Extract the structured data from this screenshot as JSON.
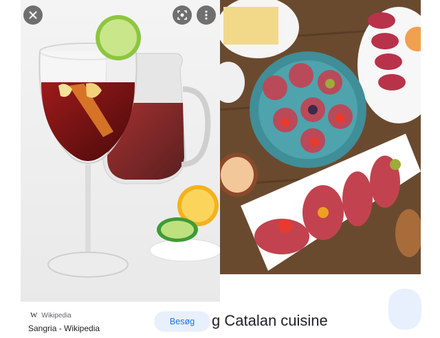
{
  "left_result": {
    "image_alt": "Sangria",
    "source_name": "Wikipedia",
    "source_icon": "wikipedia-w",
    "title": "Sangria - Wikipedia",
    "visit_label": "Besøg",
    "controls": [
      "close-icon",
      "lens-icon",
      "more-vert-icon"
    ]
  },
  "right_result": {
    "image_alt": "Catalan tapas",
    "caption": "g Catalan cuisine"
  },
  "colors": {
    "accent": "#1a73e8",
    "button_bg": "#e8f0fe",
    "text": "#202124",
    "muted": "#5f6368"
  }
}
